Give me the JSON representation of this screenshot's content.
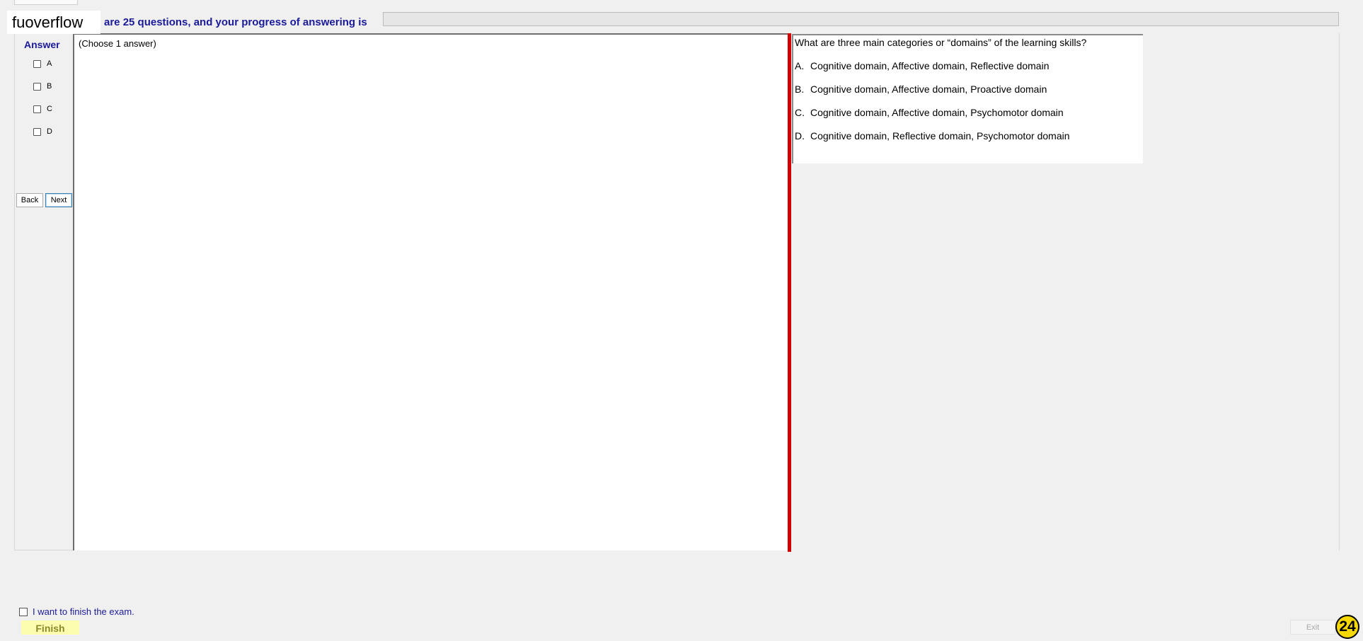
{
  "header": {
    "brand": "fuoverflow",
    "progress_text": "are 25 questions, and your progress of answering is",
    "progress_value": 0
  },
  "answer_column": {
    "title": "Answer",
    "options": [
      "A",
      "B",
      "C",
      "D"
    ],
    "back_label": "Back",
    "next_label": "Next"
  },
  "answer_panel": {
    "instruction": "(Choose 1 answer)"
  },
  "question": {
    "text": "What are three main categories or “domains” of the learning skills?",
    "options": [
      {
        "letter": "A.",
        "text": "Cognitive domain, Affective domain, Reflective domain"
      },
      {
        "letter": "B.",
        "text": "Cognitive domain, Affective domain, Proactive domain"
      },
      {
        "letter": "C.",
        "text": "Cognitive domain, Affective domain, Psychomotor domain"
      },
      {
        "letter": "D.",
        "text": "Cognitive domain, Reflective domain, Psychomotor domain"
      }
    ]
  },
  "footer": {
    "finish_checkbox_label": "I want to finish the exam.",
    "finish_label": "Finish",
    "exit_label": "Exit",
    "badge_number": "24"
  },
  "colors": {
    "accent_text": "#1a1a9a",
    "splitter": "#d40000",
    "finish_bg": "#fdfdb0",
    "badge_bg": "#f5d800"
  }
}
